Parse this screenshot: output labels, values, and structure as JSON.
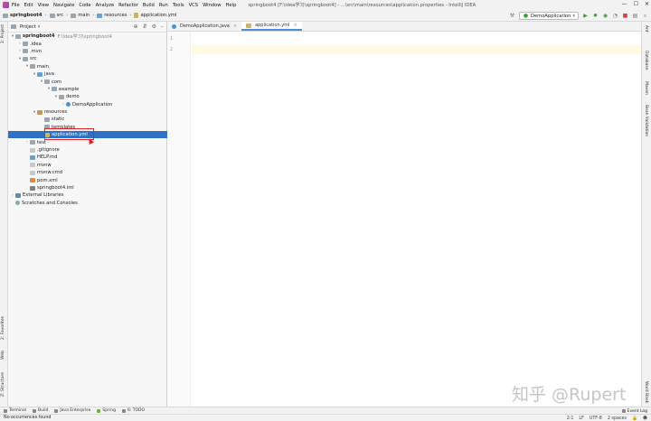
{
  "menubar": {
    "items": [
      "File",
      "Edit",
      "View",
      "Navigate",
      "Code",
      "Analyze",
      "Refactor",
      "Build",
      "Run",
      "Tools",
      "VCS",
      "Window",
      "Help"
    ],
    "window_title": "springboot4 [F:\\idea学习\\springboot4] - ...\\src\\main\\resources\\application.properties - IntelliJ IDEA"
  },
  "navbar": {
    "crumbs": [
      "springboot4",
      "src",
      "main",
      "resources",
      "application.yml"
    ],
    "run_config": "DemoApplication"
  },
  "left_strip": {
    "tabs": [
      "1: Project",
      "2: Favorites",
      "Web",
      "Z: Structure"
    ]
  },
  "project_panel": {
    "title": "Project",
    "tree": [
      {
        "label": "springboot4",
        "hint": "F:\\idea学习\\springboot4",
        "arrow": "▾",
        "icon": "folder"
      },
      {
        "label": ".idea",
        "arrow": "›",
        "icon": "folder"
      },
      {
        "label": ".mvn",
        "arrow": "›",
        "icon": "folder"
      },
      {
        "label": "src",
        "arrow": "▾",
        "icon": "folder"
      },
      {
        "label": "main",
        "arrow": "▾",
        "icon": "folder"
      },
      {
        "label": "java",
        "arrow": "▾",
        "icon": "src"
      },
      {
        "label": "com",
        "arrow": "▾",
        "icon": "pkg"
      },
      {
        "label": "example",
        "arrow": "▾",
        "icon": "pkg"
      },
      {
        "label": "demo",
        "arrow": "▾",
        "icon": "pkg"
      },
      {
        "label": "DemoApplication",
        "arrow": "›",
        "icon": "class"
      },
      {
        "label": "resources",
        "arrow": "▾",
        "icon": "res"
      },
      {
        "label": "static",
        "arrow": "",
        "icon": "folder"
      },
      {
        "label": "templates",
        "arrow": "",
        "icon": "folder"
      },
      {
        "label": "application.yml",
        "arrow": "",
        "icon": "yml"
      },
      {
        "label": "test",
        "arrow": "›",
        "icon": "folder"
      },
      {
        "label": ".gitignore",
        "arrow": "",
        "icon": "file"
      },
      {
        "label": "HELP.md",
        "arrow": "",
        "icon": "md"
      },
      {
        "label": "mvnw",
        "arrow": "",
        "icon": "file"
      },
      {
        "label": "mvnw.cmd",
        "arrow": "",
        "icon": "file"
      },
      {
        "label": "pom.xml",
        "arrow": "",
        "icon": "xml"
      },
      {
        "label": "springboot4.iml",
        "arrow": "",
        "icon": "iml"
      },
      {
        "label": "External Libraries",
        "arrow": "›",
        "icon": "lib"
      },
      {
        "label": "Scratches and Consoles",
        "arrow": "",
        "icon": "scratch"
      }
    ]
  },
  "editor": {
    "tabs": [
      {
        "label": "DemoApplication.java",
        "active": false
      },
      {
        "label": "application.yml",
        "active": true
      }
    ],
    "line_numbers": [
      "1",
      "2"
    ]
  },
  "right_strip": {
    "tabs": [
      "Ant",
      "Database",
      "Maven",
      "Bean Validation",
      "Word Book"
    ]
  },
  "bottom_strip": {
    "tabs": [
      "Terminal",
      "Build",
      "Java Enterprise",
      "Spring",
      "6: TODO"
    ],
    "event_log": "Event Log"
  },
  "statusbar": {
    "message": "No occurrences found",
    "position": "2:1",
    "line_sep": "LF",
    "encoding": "UTF-8",
    "indent": "2 spaces"
  },
  "watermark": "知乎 @Rupert"
}
